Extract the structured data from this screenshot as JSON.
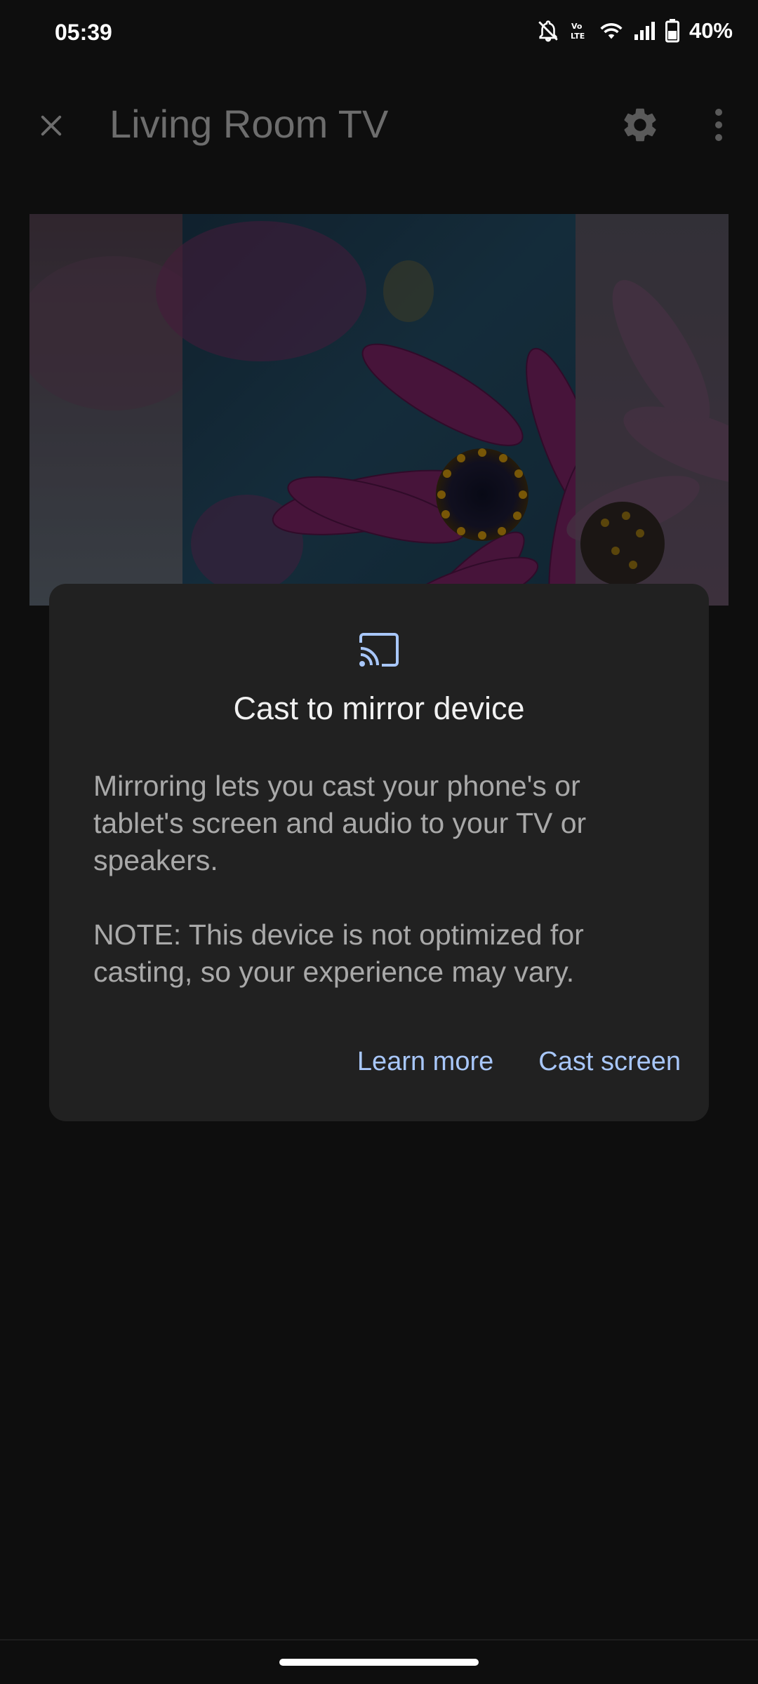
{
  "status_bar": {
    "time": "05:39",
    "battery_percent": "40%",
    "icons": [
      "notifications-off-icon",
      "volte-icon",
      "wifi-icon",
      "cell-signal-icon",
      "battery-icon"
    ]
  },
  "app_bar": {
    "title": "Living Room TV",
    "icons": [
      "close-icon",
      "settings-icon",
      "more-vert-icon"
    ]
  },
  "dialog": {
    "icon": "cast-icon",
    "title": "Cast to mirror device",
    "body_paragraph_1": "Mirroring lets you cast your phone's or tablet's screen and audio to your TV or speakers.",
    "body_paragraph_2": "NOTE: This device is not optimized for casting, so your experience may vary.",
    "learn_more_label": "Learn more",
    "cast_screen_label": "Cast screen"
  },
  "colors": {
    "background": "#0e0e0e",
    "dialog_surface": "#212121",
    "accent": "#a8c7fa",
    "title_dimmed": "#6d6d6d"
  }
}
